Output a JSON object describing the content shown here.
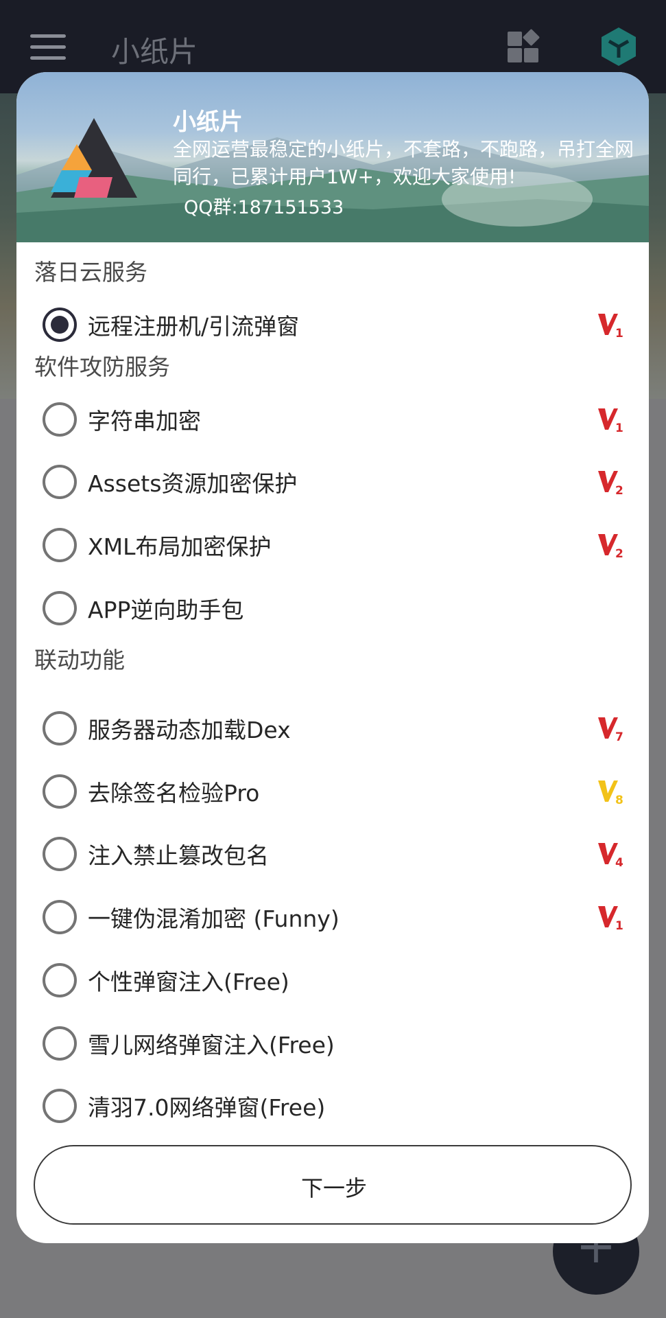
{
  "app": {
    "title": "小纸片"
  },
  "fab": {
    "icon": "plus-icon",
    "label": "+"
  },
  "dialog": {
    "banner": {
      "title": "小纸片",
      "description": "全网运营最稳定的小纸片，不套路，不跑路，吊打全网同行，已累计用户1W+，欢迎大家使用!",
      "qq": "QQ群:187151533"
    },
    "sections": [
      {
        "title": "落日云服务"
      },
      {
        "title": "软件攻防服务"
      },
      {
        "title": "联动功能"
      }
    ],
    "options": [
      {
        "label": "远程注册机/引流弹窗",
        "checked": true,
        "vip": "1",
        "vip_color": "#d6282c"
      },
      {
        "label": "字符串加密",
        "checked": false,
        "vip": "1",
        "vip_color": "#d6282c"
      },
      {
        "label": "Assets资源加密保护",
        "checked": false,
        "vip": "2",
        "vip_color": "#d6282c"
      },
      {
        "label": "XML布局加密保护",
        "checked": false,
        "vip": "2",
        "vip_color": "#d6282c"
      },
      {
        "label": "APP逆向助手包",
        "checked": false,
        "vip": "",
        "vip_color": ""
      },
      {
        "label": "服务器动态加载Dex",
        "checked": false,
        "vip": "7",
        "vip_color": "#d6282c"
      },
      {
        "label": "去除签名检验Pro",
        "checked": false,
        "vip": "8",
        "vip_color": "#f2c218"
      },
      {
        "label": "注入禁止篡改包名",
        "checked": false,
        "vip": "4",
        "vip_color": "#d6282c"
      },
      {
        "label": "一键伪混淆加密 (Funny)",
        "checked": false,
        "vip": "1",
        "vip_color": "#d6282c"
      },
      {
        "label": "个性弹窗注入(Free)",
        "checked": false,
        "vip": "",
        "vip_color": ""
      },
      {
        "label": "雪儿网络弹窗注入(Free)",
        "checked": false,
        "vip": "",
        "vip_color": ""
      },
      {
        "label": "清羽7.0网络弹窗(Free)",
        "checked": false,
        "vip": "",
        "vip_color": ""
      }
    ],
    "next_button": "下一步"
  }
}
